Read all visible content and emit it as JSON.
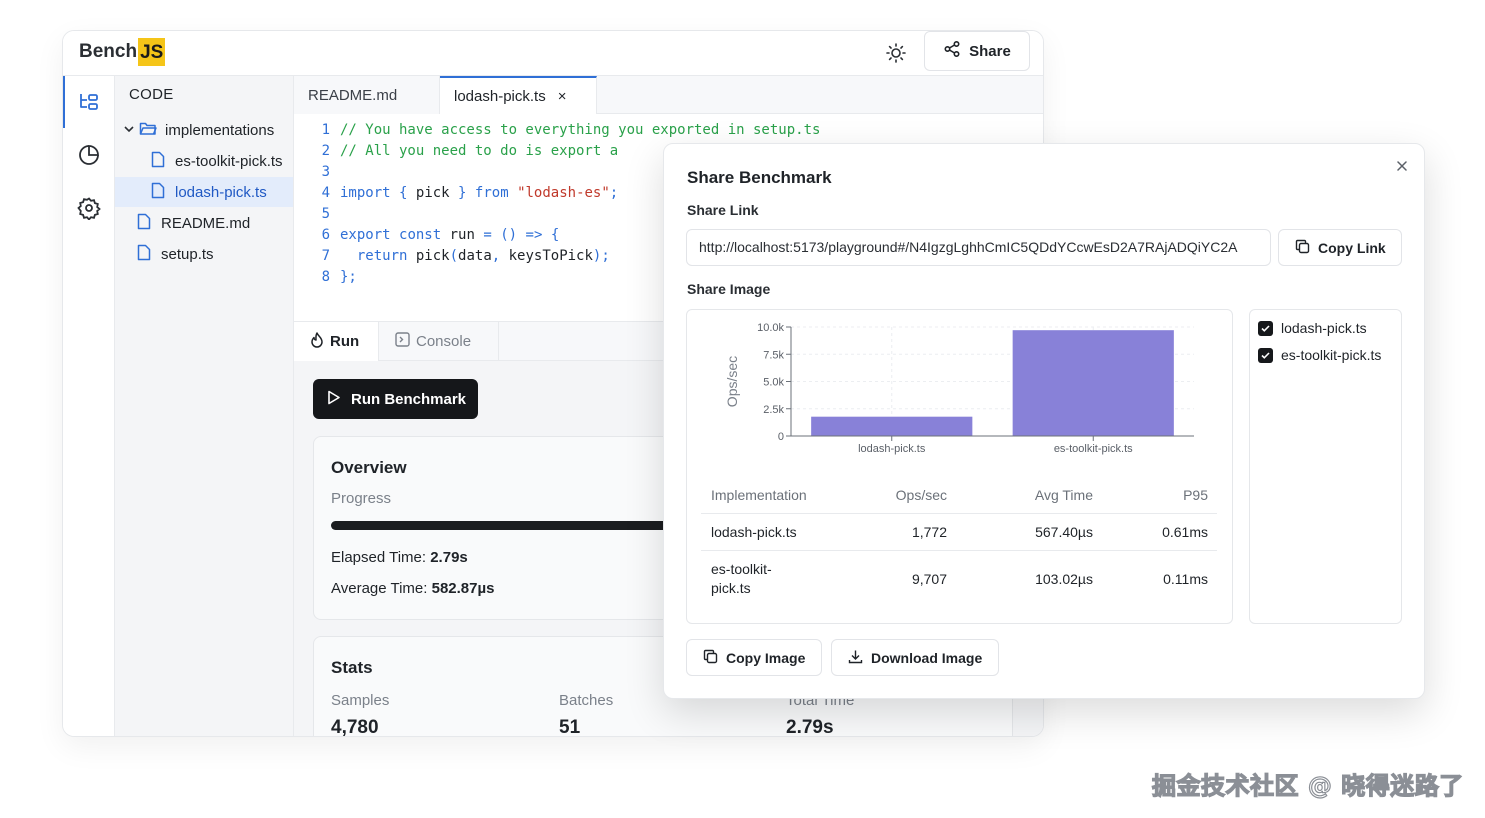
{
  "app": {
    "logo": {
      "bench": "Bench",
      "js": "JS"
    },
    "share_label": "Share",
    "icons": {
      "theme": "sun-icon",
      "share": "share-nodes-icon",
      "rail": [
        "file-tree-icon",
        "pie-chart-icon",
        "gear-icon"
      ]
    }
  },
  "explorer": {
    "heading": "CODE",
    "folder": "implementations",
    "items": [
      {
        "label": "es-toolkit-pick.ts",
        "selected": false
      },
      {
        "label": "lodash-pick.ts",
        "selected": true
      },
      {
        "label": "README.md",
        "selected": false
      },
      {
        "label": "setup.ts",
        "selected": false
      }
    ]
  },
  "editor": {
    "tabs": [
      {
        "label": "README.md",
        "active": false
      },
      {
        "label": "lodash-pick.ts",
        "active": true,
        "close": "×"
      }
    ],
    "lines": [
      {
        "n": "1",
        "text": "// You have access to everything you exported in setup.ts"
      },
      {
        "n": "2",
        "text": "// All you need to do is export a"
      },
      {
        "n": "3",
        "text": ""
      },
      {
        "n": "4",
        "text": "import { pick } from \"lodash-es\";"
      },
      {
        "n": "5",
        "text": ""
      },
      {
        "n": "6",
        "text": "export const run = () => {"
      },
      {
        "n": "7",
        "text": "  return pick(data, keysToPick);"
      },
      {
        "n": "8",
        "text": "};"
      }
    ]
  },
  "panel": {
    "tab_run": "Run",
    "tab_console": "Console",
    "run_button": "Run Benchmark",
    "overview": {
      "title": "Overview",
      "progress_label": "Progress",
      "progress_value": 1.0,
      "elapsed_label": "Elapsed Time: ",
      "elapsed_value": "2.79s",
      "average_label": "Average Time: ",
      "average_value": "582.87µs"
    },
    "stats": {
      "title": "Stats",
      "samples_label": "Samples",
      "samples_value": "4,780",
      "batches_label": "Batches",
      "batches_value": "51",
      "total_label": "Total Time",
      "total_value": "2.79s"
    }
  },
  "modal": {
    "title": "Share Benchmark",
    "close": "×",
    "share_link_label": "Share Link",
    "share_link_value": "http://localhost:5173/playground#/N4IgzgLghhCmIC5QDdYCcwEsD2A7RAjADQiYC2A",
    "copy_link": "Copy Link",
    "share_image_label": "Share Image",
    "checkboxes": [
      {
        "label": "lodash-pick.ts",
        "checked": true
      },
      {
        "label": "es-toolkit-pick.ts",
        "checked": true
      }
    ],
    "table": {
      "headers": [
        "Implementation",
        "Ops/sec",
        "Avg Time",
        "P95"
      ],
      "rows": [
        {
          "impl": "lodash-pick.ts",
          "ops": "1,772",
          "avg": "567.40µs",
          "p95": "0.61ms"
        },
        {
          "impl": "es-toolkit-pick.ts",
          "impl_l1": "es-toolkit-",
          "impl_l2": "pick.ts",
          "ops": "9,707",
          "avg": "103.02µs",
          "p95": "0.11ms"
        }
      ]
    },
    "copy_image": "Copy Image",
    "download_image": "Download Image"
  },
  "chart_data": {
    "type": "bar",
    "categories": [
      "lodash-pick.ts",
      "es-toolkit-pick.ts"
    ],
    "values": [
      1772,
      9707
    ],
    "ylabel": "Ops/sec",
    "xlabel": "",
    "ylim": [
      0,
      10000
    ],
    "yticks": [
      "0",
      "2.5k",
      "5.0k",
      "7.5k",
      "10.0k"
    ],
    "ytick_values": [
      0,
      2500,
      5000,
      7500,
      10000
    ],
    "bar_color": "#8881d8",
    "grid": true
  },
  "watermark": "掘金技术社区 @ 晓得迷路了"
}
